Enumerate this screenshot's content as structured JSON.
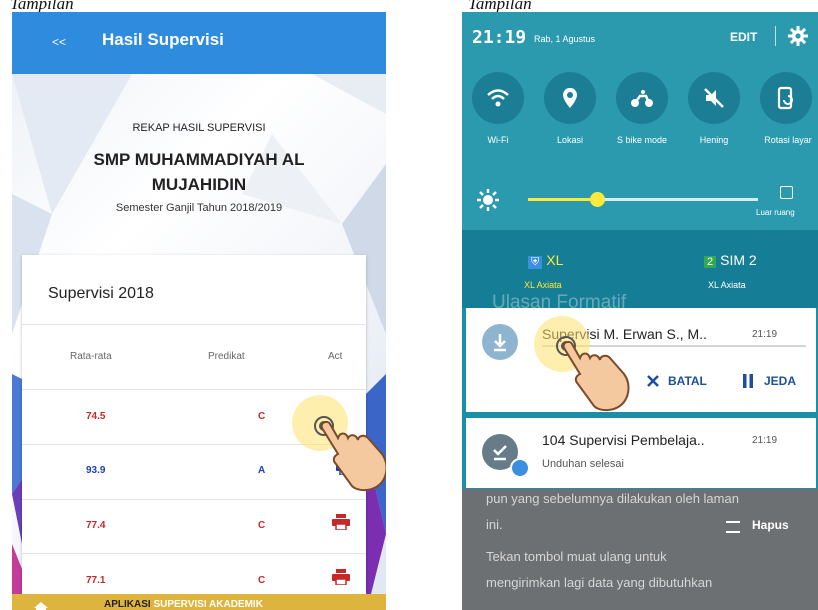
{
  "top_left_fragment": "Tampilan",
  "top_right_fragment": "Tampilan",
  "left": {
    "header": {
      "back_label": "<<",
      "title": "Hasil Supervisi"
    },
    "hero": {
      "rekap": "REKAP HASIL SUPERVISI",
      "school_line1": "SMP MUHAMMADIYAH AL",
      "school_line2": "MUJAHIDIN",
      "semester": "Semester Ganjil Tahun 2018/2019"
    },
    "card": {
      "title": "Supervisi 2018",
      "columns": [
        "Rata-rata",
        "Predikat",
        "Act"
      ],
      "rows": [
        {
          "avg": "74.5",
          "grade": "C"
        },
        {
          "avg": "93.9",
          "grade": "A"
        },
        {
          "avg": "77.4",
          "grade": "C"
        },
        {
          "avg": "77.1",
          "grade": "C"
        }
      ]
    },
    "footer": {
      "part1": "APLIKASI",
      "part2": "SUPERVISI AKADEMIK"
    },
    "colors": {
      "appbar": "#2f8bde",
      "footer": "#ddb43e",
      "grade_c": "#c62828",
      "grade_a": "#1e3fb5"
    }
  },
  "right": {
    "status": {
      "time": "21:19",
      "date": "Rab, 1 Agustus",
      "edit": "EDIT"
    },
    "quick_settings": [
      {
        "icon": "wifi-icon",
        "label": "Wi-Fi"
      },
      {
        "icon": "location-icon",
        "label": "Lokasi"
      },
      {
        "icon": "bike-icon",
        "label": "S bike mode"
      },
      {
        "icon": "mute-icon",
        "label": "Hening"
      },
      {
        "icon": "rotate-icon",
        "label": "Rotasi layar"
      }
    ],
    "brightness": {
      "level": 0.3,
      "outdoor_label": "Luar ruang"
    },
    "sims": [
      {
        "badge": "",
        "name": "XL",
        "carrier": "XL Axiata"
      },
      {
        "badge": "2",
        "name": "SIM 2",
        "carrier": "XL Axiata"
      }
    ],
    "background_title": "Ulasan Formatif",
    "notifications": [
      {
        "title": "Supervisi M. Erwan S., M..",
        "time": "21:19",
        "cancel": "BATAL",
        "pause": "JEDA"
      },
      {
        "title": "104 Supervisi Pembelaja..",
        "time": "21:19",
        "status": "Unduhan selesai"
      }
    ],
    "lower": {
      "line1": "pun yang sebelumnya dilakukan oleh laman",
      "line2": "ini.",
      "line3": "Tekan tombol muat ulang untuk",
      "line4": "mengirimkan lagi data yang dibutuhkan",
      "clear": "Hapus"
    },
    "colors": {
      "panel": "#2b9aae",
      "icon_bg": "#1b7e95",
      "accent": "#ffe93a"
    }
  }
}
